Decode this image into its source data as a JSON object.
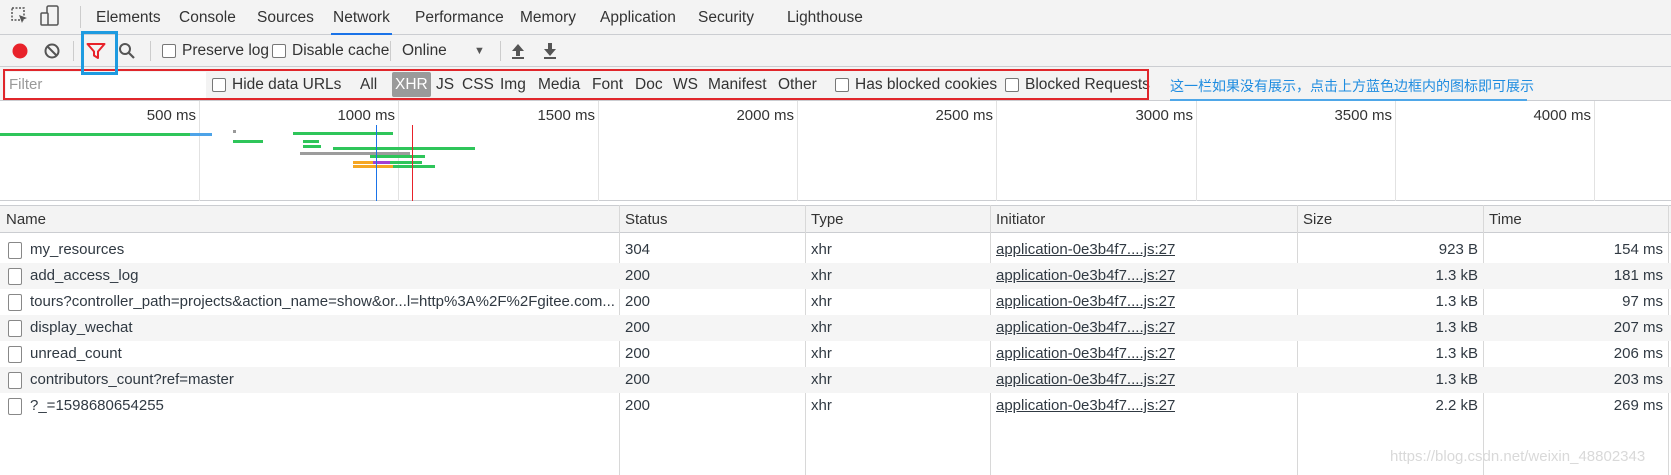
{
  "tabs": [
    "Elements",
    "Console",
    "Sources",
    "Network",
    "Performance",
    "Memory",
    "Application",
    "Security",
    "Lighthouse"
  ],
  "active_tab": "Network",
  "toolbar": {
    "preserve_log": "Preserve log",
    "disable_cache": "Disable cache",
    "throttle": "Online"
  },
  "filter": {
    "placeholder": "Filter",
    "hide_data_urls": "Hide data URLs",
    "types": [
      "All",
      "XHR",
      "JS",
      "CSS",
      "Img",
      "Media",
      "Font",
      "Doc",
      "WS",
      "Manifest",
      "Other"
    ],
    "selected_type": "XHR",
    "has_blocked_cookies": "Has blocked cookies",
    "blocked_requests": "Blocked Requests"
  },
  "annotation": "这一栏如果没有展示，点击上方蓝色边框内的图标即可展示",
  "overview": {
    "ticks": [
      "500 ms",
      "1000 ms",
      "1500 ms",
      "2000 ms",
      "2500 ms",
      "3000 ms",
      "3500 ms",
      "4000 ms"
    ]
  },
  "columns": [
    "Name",
    "Status",
    "Type",
    "Initiator",
    "Size",
    "Time"
  ],
  "rows": [
    {
      "name": "my_resources",
      "status": "304",
      "type": "xhr",
      "initiator": "application-0e3b4f7....js:27",
      "size": "923 B",
      "time": "154 ms"
    },
    {
      "name": "add_access_log",
      "status": "200",
      "type": "xhr",
      "initiator": "application-0e3b4f7....js:27",
      "size": "1.3 kB",
      "time": "181 ms"
    },
    {
      "name": "tours?controller_path=projects&action_name=show&or...l=http%3A%2F%2Fgitee.com...",
      "status": "200",
      "type": "xhr",
      "initiator": "application-0e3b4f7....js:27",
      "size": "1.3 kB",
      "time": "97 ms"
    },
    {
      "name": "display_wechat",
      "status": "200",
      "type": "xhr",
      "initiator": "application-0e3b4f7....js:27",
      "size": "1.3 kB",
      "time": "207 ms"
    },
    {
      "name": "unread_count",
      "status": "200",
      "type": "xhr",
      "initiator": "application-0e3b4f7....js:27",
      "size": "1.3 kB",
      "time": "206 ms"
    },
    {
      "name": "contributors_count?ref=master",
      "status": "200",
      "type": "xhr",
      "initiator": "application-0e3b4f7....js:27",
      "size": "1.3 kB",
      "time": "203 ms"
    },
    {
      "name": "?_=1598680654255",
      "status": "200",
      "type": "xhr",
      "initiator": "application-0e3b4f7....js:27",
      "size": "2.2 kB",
      "time": "269 ms"
    }
  ],
  "watermark": "https://blog.csdn.net/weixin_48802343",
  "colors": {
    "accent": "#1a73e8",
    "record": "#e8222a",
    "highlight_blue": "#1e9be0",
    "highlight_red": "#e0262b",
    "annotation": "#1e8ce0"
  }
}
